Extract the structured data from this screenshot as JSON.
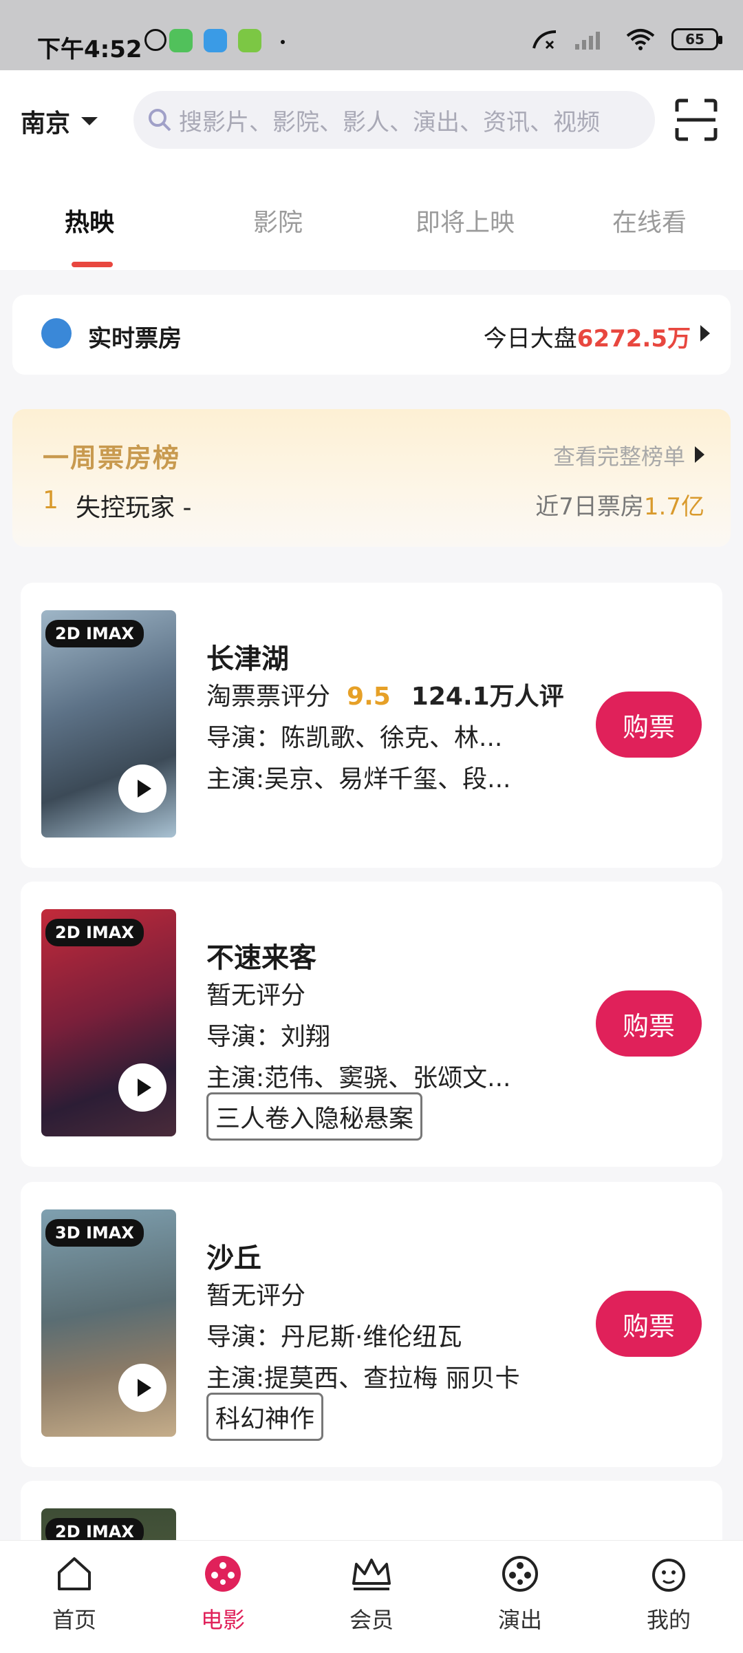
{
  "status": {
    "time": "下午4:52",
    "battery": "65"
  },
  "header": {
    "city": "南京",
    "search_placeholder": "搜影片、影院、影人、演出、资讯、视频"
  },
  "tabs": [
    {
      "label": "热映"
    },
    {
      "label": "影院"
    },
    {
      "label": "即将上映"
    },
    {
      "label": "在线看"
    }
  ],
  "box_office": {
    "title": "实时票房",
    "prefix": "今日大盘",
    "value": "6272.5万"
  },
  "weekly": {
    "title": "一周票房榜",
    "more": "查看完整榜单",
    "rank": "1",
    "movie": "失控玩家",
    "dash": "-",
    "label": "近7日票房",
    "value": "1.7亿"
  },
  "movies": [
    {
      "tag": "2D IMAX",
      "title": "长津湖",
      "rating_label": "淘票票评分",
      "score": "9.5",
      "votes": "124.1万人评",
      "director": "导演：陈凯歌、徐克、林...",
      "cast": "主演:吴京、易烊千玺、段...",
      "buy": "购票"
    },
    {
      "tag": "2D IMAX",
      "title": "不速来客",
      "rating_label": "暂无评分",
      "director": "导演：刘翔",
      "cast": "主演:范伟、窦骁、张颂文...",
      "badge": "三人卷入隐秘悬案",
      "buy": "购票"
    },
    {
      "tag": "3D IMAX",
      "title": "沙丘",
      "rating_label": "暂无评分",
      "director": "导演：丹尼斯·维伦纽瓦",
      "cast": "主演:提莫西、查拉梅 丽贝卡",
      "badge": "科幻神作",
      "buy": "购票"
    },
    {
      "tag": "2D IMAX"
    }
  ],
  "bottom_nav": [
    {
      "label": "首页"
    },
    {
      "label": "电影"
    },
    {
      "label": "会员"
    },
    {
      "label": "演出"
    },
    {
      "label": "我的"
    }
  ]
}
